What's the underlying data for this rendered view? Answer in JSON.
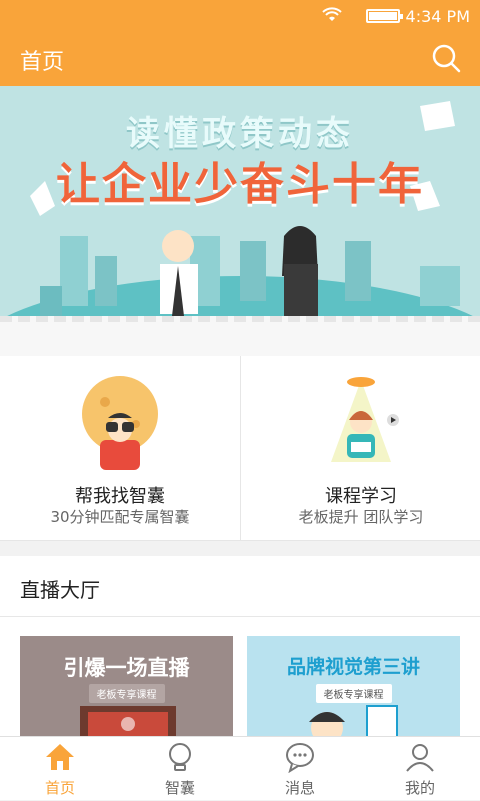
{
  "status": {
    "time": "4:34 PM"
  },
  "header": {
    "title": "首页",
    "search_icon": "search-icon"
  },
  "banner": {
    "line1": "读懂政策动态",
    "line2": "让企业少奋斗十年"
  },
  "features": [
    {
      "title": "帮我找智囊",
      "subtitle": "30分钟匹配专属智囊",
      "icon": "binoculars-person-icon"
    },
    {
      "title": "课程学习",
      "subtitle": "老板提升 团队学习",
      "icon": "teacher-lamp-icon"
    }
  ],
  "live": {
    "title": "直播大厅",
    "cards": [
      {
        "title": "引爆一场直播",
        "tag": "老板专享课程"
      },
      {
        "title": "品牌视觉第三讲",
        "tag": "老板专享课程"
      }
    ]
  },
  "tabs": [
    {
      "label": "首页",
      "icon": "home-icon",
      "active": true
    },
    {
      "label": "智囊",
      "icon": "bulb-icon",
      "active": false
    },
    {
      "label": "消息",
      "icon": "chat-icon",
      "active": false
    },
    {
      "label": "我的",
      "icon": "user-icon",
      "active": false
    }
  ],
  "colors": {
    "accent": "#f9a43a",
    "banner_bg": "#bfe3e3",
    "banner_accent": "#f0643a"
  }
}
